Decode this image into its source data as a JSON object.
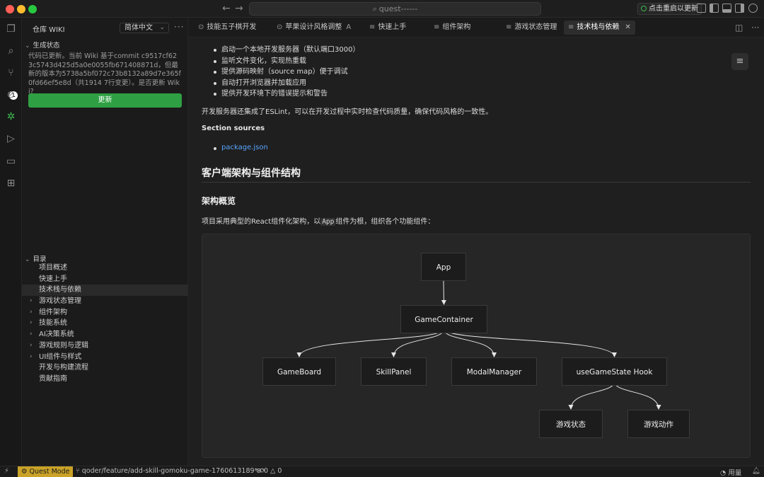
{
  "titlebar": {
    "search_text": "quest------",
    "update_button": "点击重启以更新"
  },
  "activity": {
    "scm_badge": "1"
  },
  "sidebar": {
    "title": "仓库 WIKI",
    "language": "简体中文",
    "gen_section": "生成状态",
    "gen_text": "代码已更新。当前 Wiki 基于commit c9517cf623c5743d425d5a0e0055fb671408871d，但最新的版本为5738a5bf072c73b8132a89d7e365f0fd66ef5e8d（共1914 7行变更）。是否更新 Wiki?",
    "update_button": "更新",
    "toc_section": "目录",
    "toc": [
      {
        "label": "项目概述",
        "expandable": false,
        "active": false
      },
      {
        "label": "快速上手",
        "expandable": false,
        "active": false
      },
      {
        "label": "技术栈与依赖",
        "expandable": false,
        "active": true
      },
      {
        "label": "游戏状态管理",
        "expandable": true,
        "active": false
      },
      {
        "label": "组件架构",
        "expandable": true,
        "active": false
      },
      {
        "label": "技能系统",
        "expandable": true,
        "active": false
      },
      {
        "label": "AI决策系统",
        "expandable": true,
        "active": false
      },
      {
        "label": "游戏规则与逻辑",
        "expandable": true,
        "active": false
      },
      {
        "label": "UI组件与样式",
        "expandable": true,
        "active": false
      },
      {
        "label": "开发与构建流程",
        "expandable": false,
        "active": false
      },
      {
        "label": "贡献指南",
        "expandable": false,
        "active": false
      }
    ]
  },
  "tabs": [
    {
      "label": "技能五子棋开发",
      "icon": "chat-icon",
      "tag": ""
    },
    {
      "label": "苹果设计风格调整",
      "icon": "chat-icon",
      "tag": "A"
    },
    {
      "label": "快速上手",
      "icon": "doc-icon",
      "tag": ""
    },
    {
      "label": "组件架构",
      "icon": "doc-icon",
      "tag": ""
    },
    {
      "label": "游戏状态管理",
      "icon": "doc-icon",
      "tag": ""
    },
    {
      "label": "技术栈与依赖",
      "icon": "doc-icon",
      "tag": ""
    }
  ],
  "content": {
    "bullets": [
      "启动一个本地开发服务器（默认端口3000）",
      "监听文件变化，实现热重载",
      "提供源码映射（source map）便于调试",
      "自动打开浏览器并加载应用",
      "提供开发环境下的错误提示和警告"
    ],
    "para1": "开发服务器还集成了ESLint，可以在开发过程中实时检查代码质量，确保代码风格的一致性。",
    "sources_heading": "Section sources",
    "source_link": "package.json",
    "h2": "客户端架构与组件结构",
    "h3": "架构概览",
    "para2_before": "项目采用典型的React组件化架构，以",
    "para2_code": "App",
    "para2_after": "组件为根，组织各个功能组件："
  },
  "diagram": {
    "nodes": {
      "app": "App",
      "container": "GameContainer",
      "board": "GameBoard",
      "skill": "SkillPanel",
      "modal": "ModalManager",
      "hook": "useGameState Hook",
      "state": "游戏状态",
      "action": "游戏动作"
    },
    "edges": [
      [
        "app",
        "container"
      ],
      [
        "container",
        "board"
      ],
      [
        "container",
        "skill"
      ],
      [
        "container",
        "modal"
      ],
      [
        "container",
        "hook"
      ],
      [
        "hook",
        "state"
      ],
      [
        "hook",
        "action"
      ]
    ]
  },
  "statusbar": {
    "mode": "Quest Mode",
    "branch": "qoder/feature/add-skill-gomoku-game-1760613189*",
    "errors": "0",
    "warnings": "0",
    "usage": "用量"
  }
}
